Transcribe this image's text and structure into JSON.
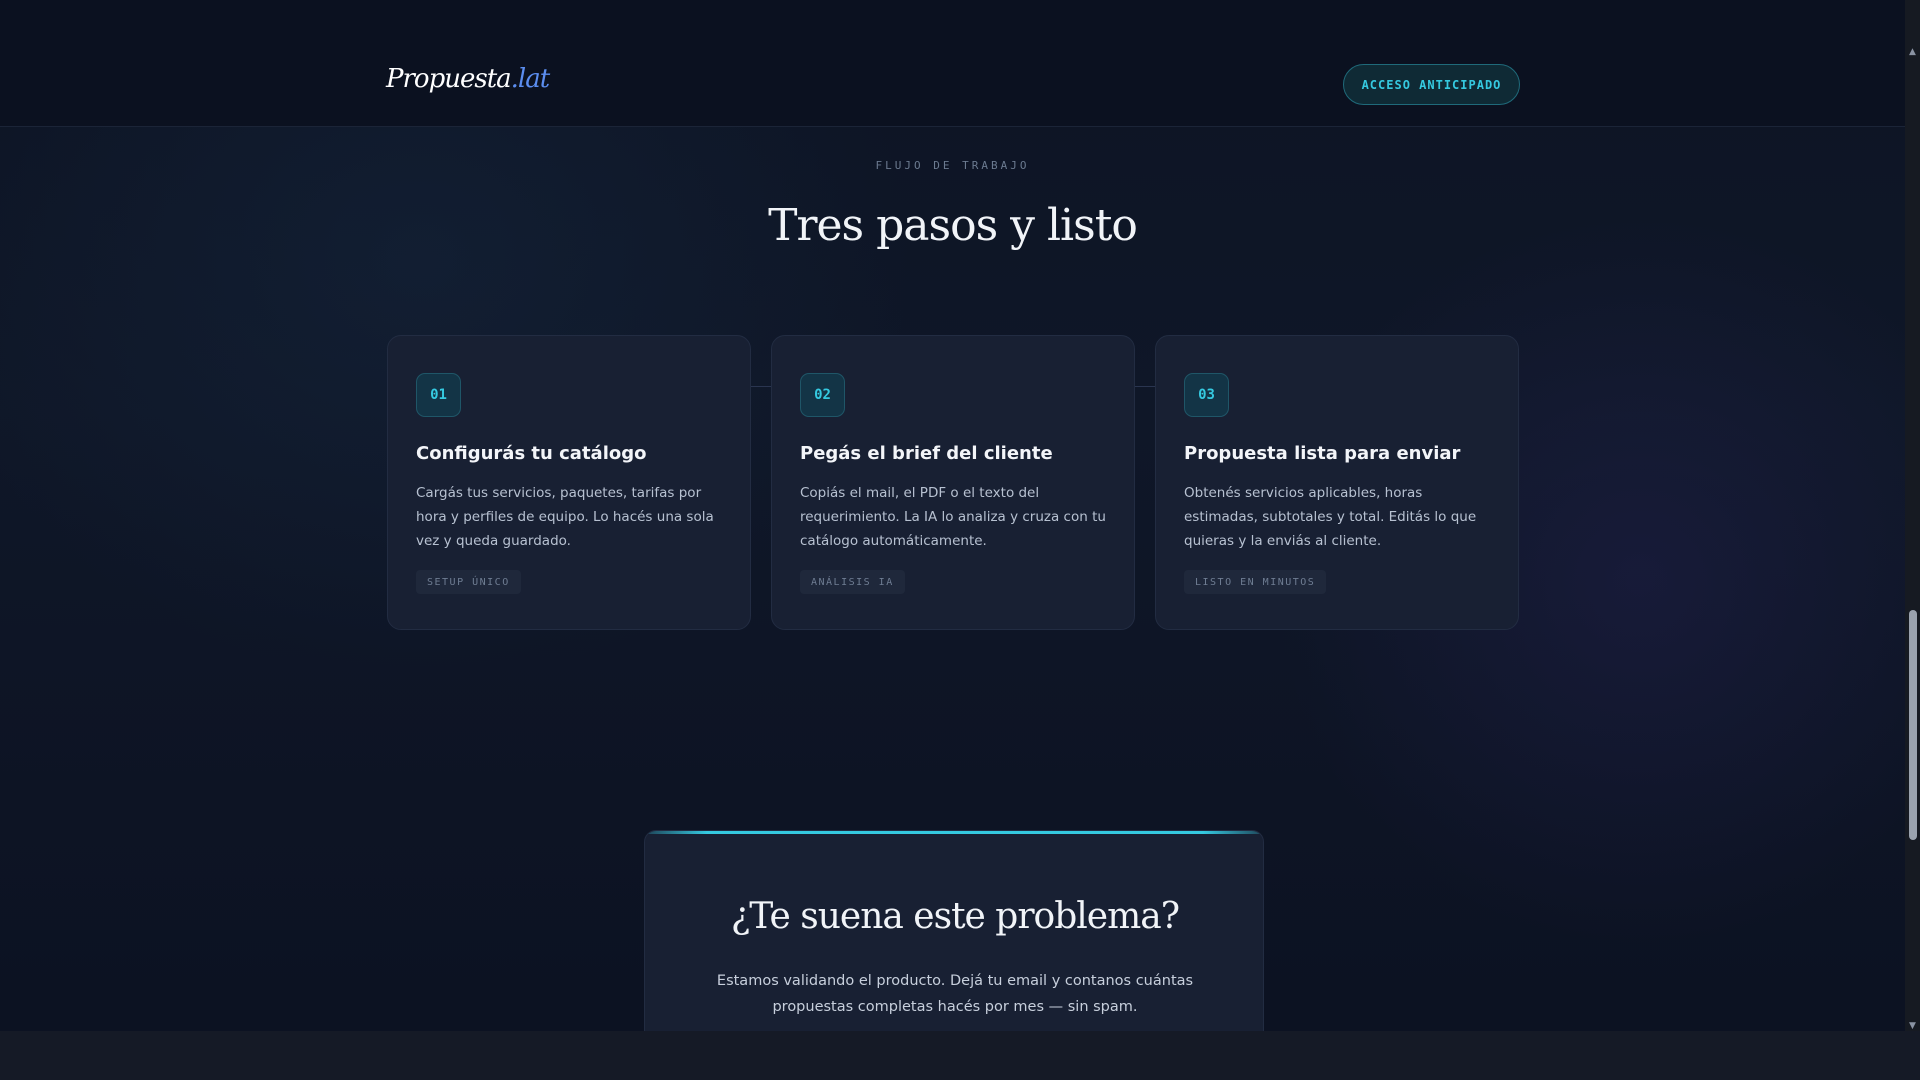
{
  "header": {
    "logo_main": "Propuesta",
    "logo_tld": ".lat",
    "cta_label": "ACCESO ANTICIPADO"
  },
  "workflow": {
    "eyebrow": "FLUJO DE TRABAJO",
    "title": "Tres pasos y listo",
    "steps": [
      {
        "number": "01",
        "title": "Configurás tu catálogo",
        "text": "Cargás tus servicios, paquetes, tarifas por hora y perfiles de equipo. Lo hacés una sola vez y queda guardado.",
        "tag": "SETUP ÚNICO"
      },
      {
        "number": "02",
        "title": "Pegás el brief del cliente",
        "text": "Copiás el mail, el PDF o el texto del requerimiento. La IA lo analiza y cruza con tu catálogo automáticamente.",
        "tag": "ANÁLISIS IA"
      },
      {
        "number": "03",
        "title": "Propuesta lista para enviar",
        "text": "Obtenés servicios aplicables, horas estimadas, subtotales y total. Editás lo que quieras y la enviás al cliente.",
        "tag": "LISTO EN MINUTOS"
      }
    ]
  },
  "problem": {
    "title": "¿Te suena este problema?",
    "text": "Estamos validando el producto. Dejá tu email y contanos cuántas propuestas completas hacés por mes — sin spam."
  },
  "colors": {
    "accent": "#35c9e0",
    "brand_blue": "#5b8def",
    "background": "#0b1120",
    "card": "#182033"
  },
  "icons": {
    "scroll_up": "triangle-up",
    "scroll_down": "triangle-down"
  }
}
